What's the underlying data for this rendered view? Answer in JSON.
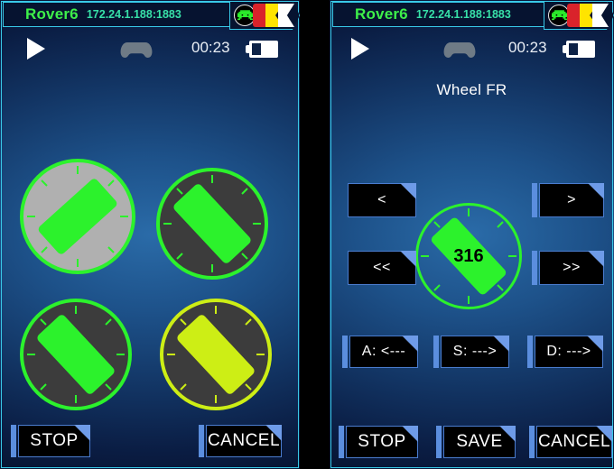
{
  "app": {
    "device_name": "Rover6",
    "address": "172.24.1.188:1883",
    "logo_icon": "space-invader-logo",
    "accent_cyan": "#39c9e8",
    "accent_green": "#3ef04a",
    "accent_teal": "#37e0a8"
  },
  "status": {
    "play_icon": "play-icon",
    "gamepad_icon": "gamepad-icon",
    "clock": "00:23",
    "battery_icon": "battery-icon"
  },
  "left_panel": {
    "dials": [
      {
        "name": "wheel-fl",
        "value": "",
        "fill": "#b0b0b0",
        "stroke": "#2cf22c",
        "needle": "#2cf22c",
        "angle": -42,
        "selected": true
      },
      {
        "name": "wheel-fr",
        "value": "",
        "fill": "#3c3c3c",
        "stroke": "#2cf22c",
        "needle": "#2cf22c",
        "angle": 47,
        "selected": false
      },
      {
        "name": "wheel-bl",
        "value": "",
        "fill": "#3c3c3c",
        "stroke": "#2cf22c",
        "needle": "#2cf22c",
        "angle": 47,
        "selected": false
      },
      {
        "name": "wheel-br",
        "value": "",
        "fill": "#3c3c3c",
        "stroke": "#cdee15",
        "needle": "#cdee15",
        "angle": 47,
        "selected": false
      }
    ],
    "buttons": [
      {
        "name": "stop-button",
        "label": "STOP"
      },
      {
        "name": "cancel-button",
        "label": "CANCEL"
      }
    ]
  },
  "right_panel": {
    "title": "Wheel FR",
    "dial": {
      "name": "wheel-fr-dial",
      "value": "316",
      "fill": "transparent",
      "stroke": "#2cf22c",
      "needle": "#2cf22c",
      "angle": 47
    },
    "nudge_buttons": [
      {
        "name": "step-back-button",
        "label": "<"
      },
      {
        "name": "step-forward-button",
        "label": ">"
      },
      {
        "name": "jump-back-button",
        "label": "<<"
      },
      {
        "name": "jump-forward-button",
        "label": ">>"
      }
    ],
    "key_buttons": [
      {
        "name": "key-a-button",
        "label": "A: <---"
      },
      {
        "name": "key-s-button",
        "label": "S: --->"
      },
      {
        "name": "key-d-button",
        "label": "D: --->"
      }
    ],
    "buttons": [
      {
        "name": "stop-button",
        "label": "STOP"
      },
      {
        "name": "save-button",
        "label": "SAVE"
      },
      {
        "name": "cancel-button",
        "label": "CANCEL"
      }
    ]
  }
}
